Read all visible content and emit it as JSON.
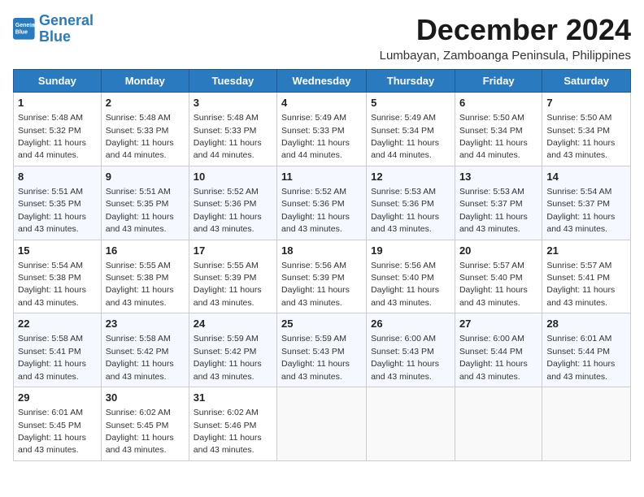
{
  "logo": {
    "line1": "General",
    "line2": "Blue"
  },
  "title": "December 2024",
  "subtitle": "Lumbayan, Zamboanga Peninsula, Philippines",
  "days_of_week": [
    "Sunday",
    "Monday",
    "Tuesday",
    "Wednesday",
    "Thursday",
    "Friday",
    "Saturday"
  ],
  "weeks": [
    [
      {
        "day": 1,
        "sunrise": "5:48 AM",
        "sunset": "5:32 PM",
        "daylight": "11 hours and 44 minutes."
      },
      {
        "day": 2,
        "sunrise": "5:48 AM",
        "sunset": "5:33 PM",
        "daylight": "11 hours and 44 minutes."
      },
      {
        "day": 3,
        "sunrise": "5:48 AM",
        "sunset": "5:33 PM",
        "daylight": "11 hours and 44 minutes."
      },
      {
        "day": 4,
        "sunrise": "5:49 AM",
        "sunset": "5:33 PM",
        "daylight": "11 hours and 44 minutes."
      },
      {
        "day": 5,
        "sunrise": "5:49 AM",
        "sunset": "5:34 PM",
        "daylight": "11 hours and 44 minutes."
      },
      {
        "day": 6,
        "sunrise": "5:50 AM",
        "sunset": "5:34 PM",
        "daylight": "11 hours and 44 minutes."
      },
      {
        "day": 7,
        "sunrise": "5:50 AM",
        "sunset": "5:34 PM",
        "daylight": "11 hours and 43 minutes."
      }
    ],
    [
      {
        "day": 8,
        "sunrise": "5:51 AM",
        "sunset": "5:35 PM",
        "daylight": "11 hours and 43 minutes."
      },
      {
        "day": 9,
        "sunrise": "5:51 AM",
        "sunset": "5:35 PM",
        "daylight": "11 hours and 43 minutes."
      },
      {
        "day": 10,
        "sunrise": "5:52 AM",
        "sunset": "5:36 PM",
        "daylight": "11 hours and 43 minutes."
      },
      {
        "day": 11,
        "sunrise": "5:52 AM",
        "sunset": "5:36 PM",
        "daylight": "11 hours and 43 minutes."
      },
      {
        "day": 12,
        "sunrise": "5:53 AM",
        "sunset": "5:36 PM",
        "daylight": "11 hours and 43 minutes."
      },
      {
        "day": 13,
        "sunrise": "5:53 AM",
        "sunset": "5:37 PM",
        "daylight": "11 hours and 43 minutes."
      },
      {
        "day": 14,
        "sunrise": "5:54 AM",
        "sunset": "5:37 PM",
        "daylight": "11 hours and 43 minutes."
      }
    ],
    [
      {
        "day": 15,
        "sunrise": "5:54 AM",
        "sunset": "5:38 PM",
        "daylight": "11 hours and 43 minutes."
      },
      {
        "day": 16,
        "sunrise": "5:55 AM",
        "sunset": "5:38 PM",
        "daylight": "11 hours and 43 minutes."
      },
      {
        "day": 17,
        "sunrise": "5:55 AM",
        "sunset": "5:39 PM",
        "daylight": "11 hours and 43 minutes."
      },
      {
        "day": 18,
        "sunrise": "5:56 AM",
        "sunset": "5:39 PM",
        "daylight": "11 hours and 43 minutes."
      },
      {
        "day": 19,
        "sunrise": "5:56 AM",
        "sunset": "5:40 PM",
        "daylight": "11 hours and 43 minutes."
      },
      {
        "day": 20,
        "sunrise": "5:57 AM",
        "sunset": "5:40 PM",
        "daylight": "11 hours and 43 minutes."
      },
      {
        "day": 21,
        "sunrise": "5:57 AM",
        "sunset": "5:41 PM",
        "daylight": "11 hours and 43 minutes."
      }
    ],
    [
      {
        "day": 22,
        "sunrise": "5:58 AM",
        "sunset": "5:41 PM",
        "daylight": "11 hours and 43 minutes."
      },
      {
        "day": 23,
        "sunrise": "5:58 AM",
        "sunset": "5:42 PM",
        "daylight": "11 hours and 43 minutes."
      },
      {
        "day": 24,
        "sunrise": "5:59 AM",
        "sunset": "5:42 PM",
        "daylight": "11 hours and 43 minutes."
      },
      {
        "day": 25,
        "sunrise": "5:59 AM",
        "sunset": "5:43 PM",
        "daylight": "11 hours and 43 minutes."
      },
      {
        "day": 26,
        "sunrise": "6:00 AM",
        "sunset": "5:43 PM",
        "daylight": "11 hours and 43 minutes."
      },
      {
        "day": 27,
        "sunrise": "6:00 AM",
        "sunset": "5:44 PM",
        "daylight": "11 hours and 43 minutes."
      },
      {
        "day": 28,
        "sunrise": "6:01 AM",
        "sunset": "5:44 PM",
        "daylight": "11 hours and 43 minutes."
      }
    ],
    [
      {
        "day": 29,
        "sunrise": "6:01 AM",
        "sunset": "5:45 PM",
        "daylight": "11 hours and 43 minutes."
      },
      {
        "day": 30,
        "sunrise": "6:02 AM",
        "sunset": "5:45 PM",
        "daylight": "11 hours and 43 minutes."
      },
      {
        "day": 31,
        "sunrise": "6:02 AM",
        "sunset": "5:46 PM",
        "daylight": "11 hours and 43 minutes."
      },
      null,
      null,
      null,
      null
    ]
  ]
}
